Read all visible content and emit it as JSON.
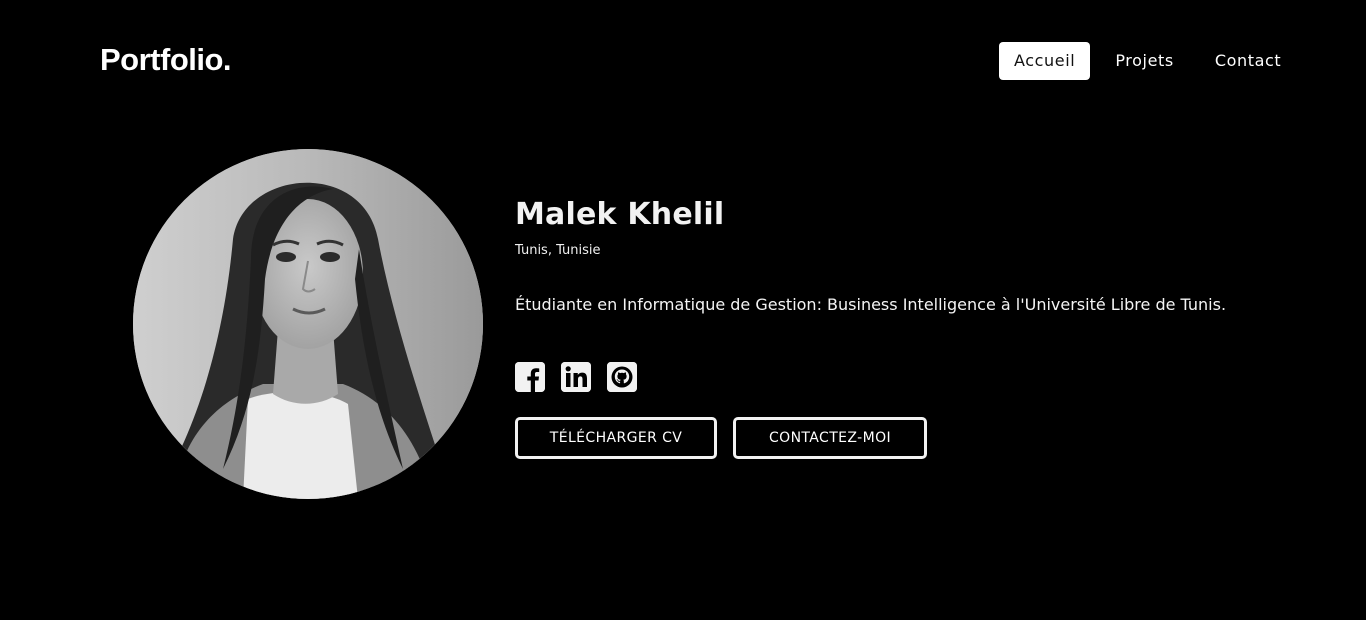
{
  "header": {
    "logo": "Portfolio.",
    "nav": [
      {
        "label": "Accueil",
        "active": true
      },
      {
        "label": "Projets",
        "active": false
      },
      {
        "label": "Contact",
        "active": false
      }
    ]
  },
  "profile": {
    "name": "Malek Khelil",
    "location": "Tunis, Tunisie",
    "bio": "Étudiante en Informatique de Gestion: Business Intelligence à l'Université Libre de Tunis.",
    "socials": [
      {
        "icon": "facebook-icon"
      },
      {
        "icon": "linkedin-icon"
      },
      {
        "icon": "github-icon"
      }
    ],
    "buttons": {
      "cv": "TÉLÉCHARGER CV",
      "contact": "CONTACTEZ-MOI"
    }
  },
  "colors": {
    "background": "#000000",
    "text": "#ffffff",
    "active_nav_bg": "#ffffff"
  }
}
